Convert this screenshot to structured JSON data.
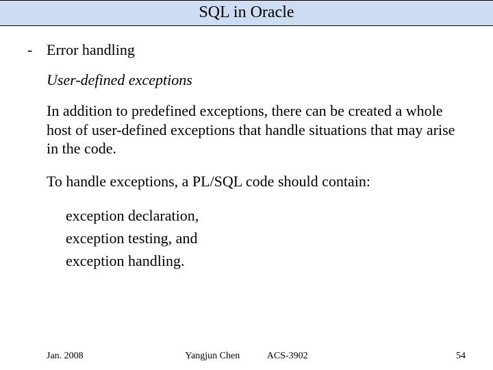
{
  "title": "SQL in Oracle",
  "bullet": {
    "dash": "-",
    "text": "Error handling"
  },
  "subhead": "User-defined exceptions",
  "para1": "In addition to predefined exceptions, there can be created a whole host of user-defined exceptions that handle situations that may arise in the code.",
  "para2": "To handle exceptions, a PL/SQL code should contain:",
  "items": [
    "exception declaration,",
    "exception testing, and",
    "exception handling."
  ],
  "footer": {
    "date": "Jan. 2008",
    "author": "Yangjun Chen",
    "course": "ACS-3902",
    "page": "54"
  }
}
